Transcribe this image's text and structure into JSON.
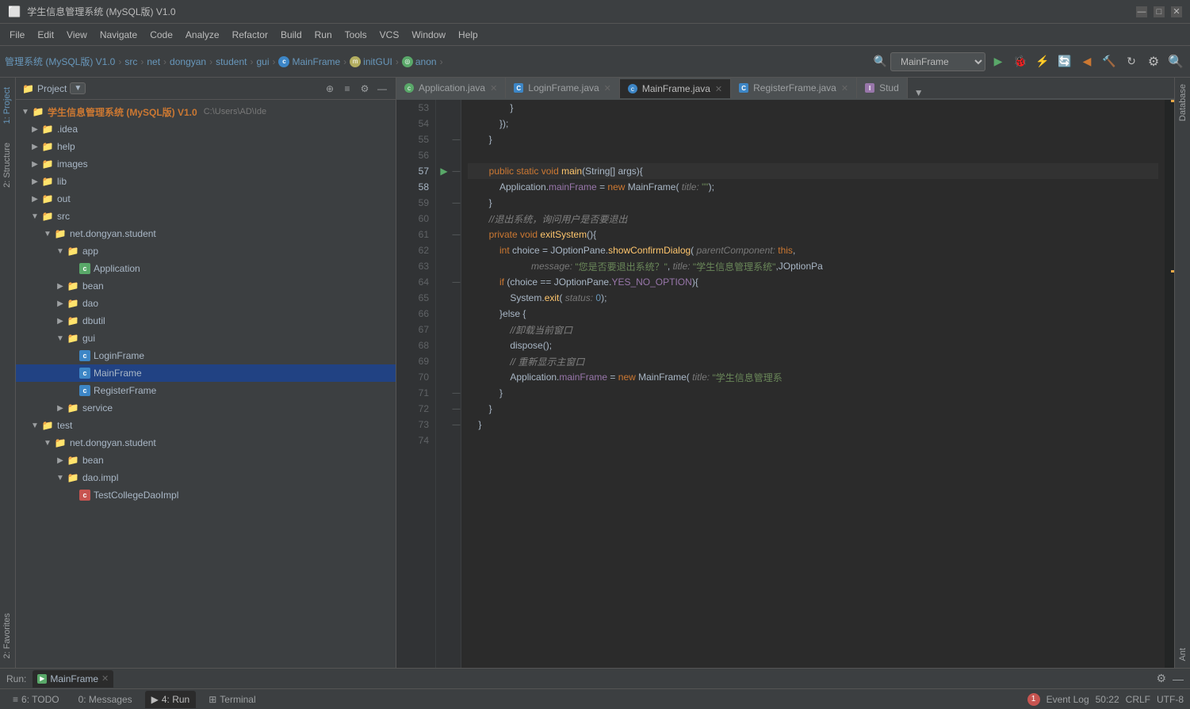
{
  "titleBar": {
    "appName": "学生信息管理系统 (MySQL版) V1.0",
    "minimize": "—",
    "maximize": "□",
    "close": "✕"
  },
  "menuBar": {
    "items": [
      "File",
      "Edit",
      "View",
      "Navigate",
      "Code",
      "Analyze",
      "Refactor",
      "Build",
      "Run",
      "Tools",
      "VCS",
      "Window",
      "Help"
    ],
    "appTitle": "学生信息管理系统 (MySQL版) V1.0"
  },
  "toolbar": {
    "breadcrumb": [
      "管理系统 (MySQL版) V1.0",
      "src",
      "net",
      "dongyan",
      "student",
      "gui",
      "MainFrame",
      "initGUI",
      "anon"
    ],
    "runConfig": "MainFrame",
    "buttons": [
      "▶",
      "🐞",
      "⚡",
      "🔄",
      "◀",
      "⏸",
      "⏹"
    ]
  },
  "sidebar": {
    "title": "Project",
    "rootLabel": "学生信息管理系统 (MySQL版) V1.0",
    "rootPath": "C:\\Users\\AD\\Ide",
    "tree": [
      {
        "indent": 1,
        "type": "folder",
        "label": ".idea",
        "expanded": false
      },
      {
        "indent": 1,
        "type": "folder",
        "label": "help",
        "expanded": false
      },
      {
        "indent": 1,
        "type": "folder",
        "label": "images",
        "expanded": false
      },
      {
        "indent": 1,
        "type": "folder",
        "label": "lib",
        "expanded": false
      },
      {
        "indent": 1,
        "type": "folder",
        "label": "out",
        "expanded": false
      },
      {
        "indent": 1,
        "type": "folder",
        "label": "src",
        "expanded": true
      },
      {
        "indent": 2,
        "type": "folder",
        "label": "net.dongyan.student",
        "expanded": true
      },
      {
        "indent": 3,
        "type": "folder",
        "label": "app",
        "expanded": true
      },
      {
        "indent": 4,
        "type": "class",
        "label": "Application",
        "color": "green"
      },
      {
        "indent": 3,
        "type": "folder",
        "label": "bean",
        "expanded": false
      },
      {
        "indent": 3,
        "type": "folder",
        "label": "dao",
        "expanded": false
      },
      {
        "indent": 3,
        "type": "folder",
        "label": "dbutil",
        "expanded": false
      },
      {
        "indent": 3,
        "type": "folder",
        "label": "gui",
        "expanded": true
      },
      {
        "indent": 4,
        "type": "class",
        "label": "LoginFrame",
        "color": "blue"
      },
      {
        "indent": 4,
        "type": "class",
        "label": "MainFrame",
        "color": "blue",
        "selected": true
      },
      {
        "indent": 4,
        "type": "class",
        "label": "RegisterFrame",
        "color": "blue"
      },
      {
        "indent": 3,
        "type": "folder",
        "label": "service",
        "expanded": false
      },
      {
        "indent": 1,
        "type": "folder",
        "label": "test",
        "expanded": true
      },
      {
        "indent": 2,
        "type": "folder",
        "label": "net.dongyan.student",
        "expanded": true
      },
      {
        "indent": 3,
        "type": "folder",
        "label": "bean",
        "expanded": false
      },
      {
        "indent": 3,
        "type": "folder",
        "label": "dao.impl",
        "expanded": true
      },
      {
        "indent": 4,
        "type": "class",
        "label": "TestCollegeDaoImpl",
        "color": "red"
      }
    ]
  },
  "tabs": [
    {
      "label": "Application.java",
      "icon": "app",
      "active": false,
      "closable": true
    },
    {
      "label": "LoginFrame.java",
      "icon": "c",
      "active": false,
      "closable": true
    },
    {
      "label": "MainFrame.java",
      "icon": "mf",
      "active": true,
      "closable": true
    },
    {
      "label": "RegisterFrame.java",
      "icon": "c",
      "active": false,
      "closable": true
    },
    {
      "label": "Stud",
      "icon": "i",
      "active": false,
      "closable": false
    }
  ],
  "codeLines": [
    {
      "num": 53,
      "content": "                }"
    },
    {
      "num": 54,
      "content": "            });"
    },
    {
      "num": 55,
      "content": "        }"
    },
    {
      "num": 56,
      "content": ""
    },
    {
      "num": 57,
      "content": "        public static void main(String[] args){",
      "hasRunArrow": true
    },
    {
      "num": 58,
      "content": "            Application.mainFrame = new MainFrame( title: \"\");"
    },
    {
      "num": 59,
      "content": "        }"
    },
    {
      "num": 60,
      "content": "        //退出系统，询问用户是否要退出",
      "isComment": true
    },
    {
      "num": 61,
      "content": "        private void exitSystem(){"
    },
    {
      "num": 62,
      "content": "            int choice = JOptionPane.showConfirmDialog( parentComponent: this,"
    },
    {
      "num": 63,
      "content": "                    message: \"您是否要退出系统？\", title: \"学生信息管理系统\",JOptionPa"
    },
    {
      "num": 64,
      "content": "            if (choice == JOptionPane.YES_NO_OPTION){"
    },
    {
      "num": 65,
      "content": "                System.exit( status: 0);"
    },
    {
      "num": 66,
      "content": "            }else {"
    },
    {
      "num": 67,
      "content": "                //卸载当前窗口",
      "isComment": true
    },
    {
      "num": 68,
      "content": "                dispose();"
    },
    {
      "num": 69,
      "content": "                // 重新显示主窗口",
      "isComment": true
    },
    {
      "num": 70,
      "content": "                Application.mainFrame = new MainFrame( title: \"学生信息管理系"
    },
    {
      "num": 71,
      "content": "            }"
    },
    {
      "num": 72,
      "content": "        }"
    },
    {
      "num": 73,
      "content": "    }"
    },
    {
      "num": 74,
      "content": ""
    }
  ],
  "bottomTabs": [
    {
      "label": "6: TODO",
      "badge": null
    },
    {
      "label": "0: Messages",
      "badge": null
    },
    {
      "label": "4: Run",
      "badge": null,
      "active": true
    },
    {
      "label": "Terminal",
      "badge": null
    }
  ],
  "statusBar": {
    "text": "50:22  CRLF  UTF-8",
    "eventLog": "Event Log",
    "eventCount": 1
  },
  "runPanel": {
    "label": "Run:",
    "tabLabel": "MainFrame"
  },
  "leftVTabs": [
    "1: Project",
    "2: Structure",
    "2: Favorites"
  ],
  "rightVTabs": [
    "Database",
    "Ant"
  ]
}
